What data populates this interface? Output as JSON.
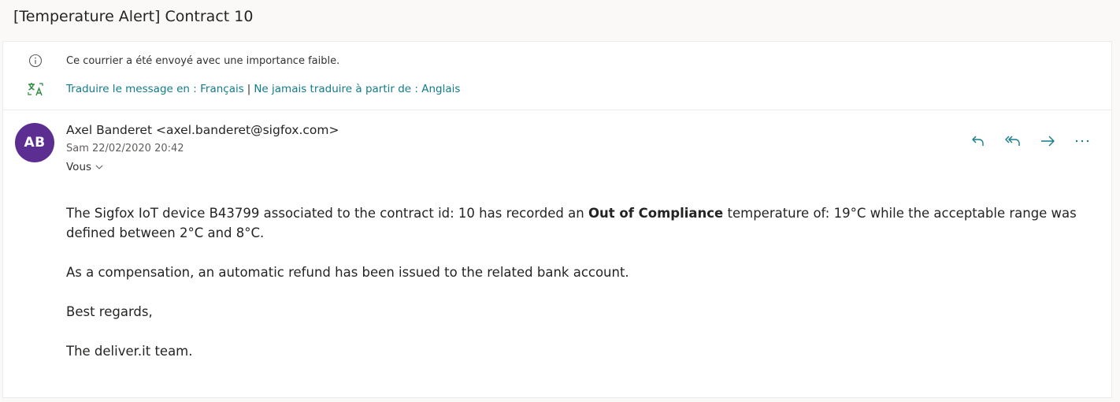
{
  "subject": "[Temperature Alert] Contract 10",
  "notices": {
    "importance_text": "Ce courrier a été envoyé avec une importance faible.",
    "importance_icon": "info-circle-icon",
    "translate_icon": "translate-icon",
    "translate_link": "Traduire le message en : Français",
    "separator": "|",
    "never_translate_link": "Ne jamais traduire à partir de : Anglais"
  },
  "message": {
    "avatar_initials": "AB",
    "avatar_color": "#5c2e91",
    "sender": "Axel Banderet <axel.banderet@sigfox.com>",
    "date": "Sam 22/02/2020 20:42",
    "recipient": "Vous",
    "actions": [
      {
        "name": "reply",
        "icon": "reply-icon"
      },
      {
        "name": "reply-all",
        "icon": "reply-all-icon"
      },
      {
        "name": "forward",
        "icon": "forward-icon"
      },
      {
        "name": "more",
        "icon": "more-icon"
      }
    ],
    "accent_color": "#127c88"
  },
  "body": {
    "p1_before": "The Sigfox IoT device B43799 associated to the contract id: 10 has recorded an ",
    "p1_bold": "Out of Compliance",
    "p1_after": " temperature of: 19°C while the acceptable range was defined between 2°C and 8°C.",
    "p2": "As a compensation, an automatic refund has been issued to the related bank account.",
    "p3": "Best regards,",
    "p4": "The deliver.it team."
  }
}
